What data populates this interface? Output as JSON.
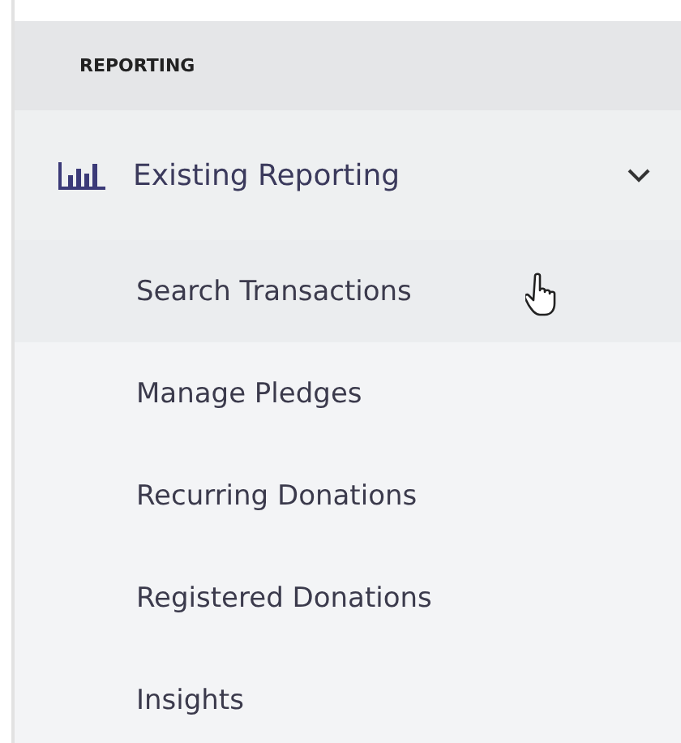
{
  "section": {
    "title": "REPORTING"
  },
  "group": {
    "label": "Existing Reporting",
    "expanded": true,
    "children": [
      {
        "label": "Search Transactions",
        "hovered": true
      },
      {
        "label": "Manage Pledges",
        "hovered": false
      },
      {
        "label": "Recurring Donations",
        "hovered": false
      },
      {
        "label": "Registered Donations",
        "hovered": false
      },
      {
        "label": "Insights",
        "hovered": false
      }
    ]
  }
}
